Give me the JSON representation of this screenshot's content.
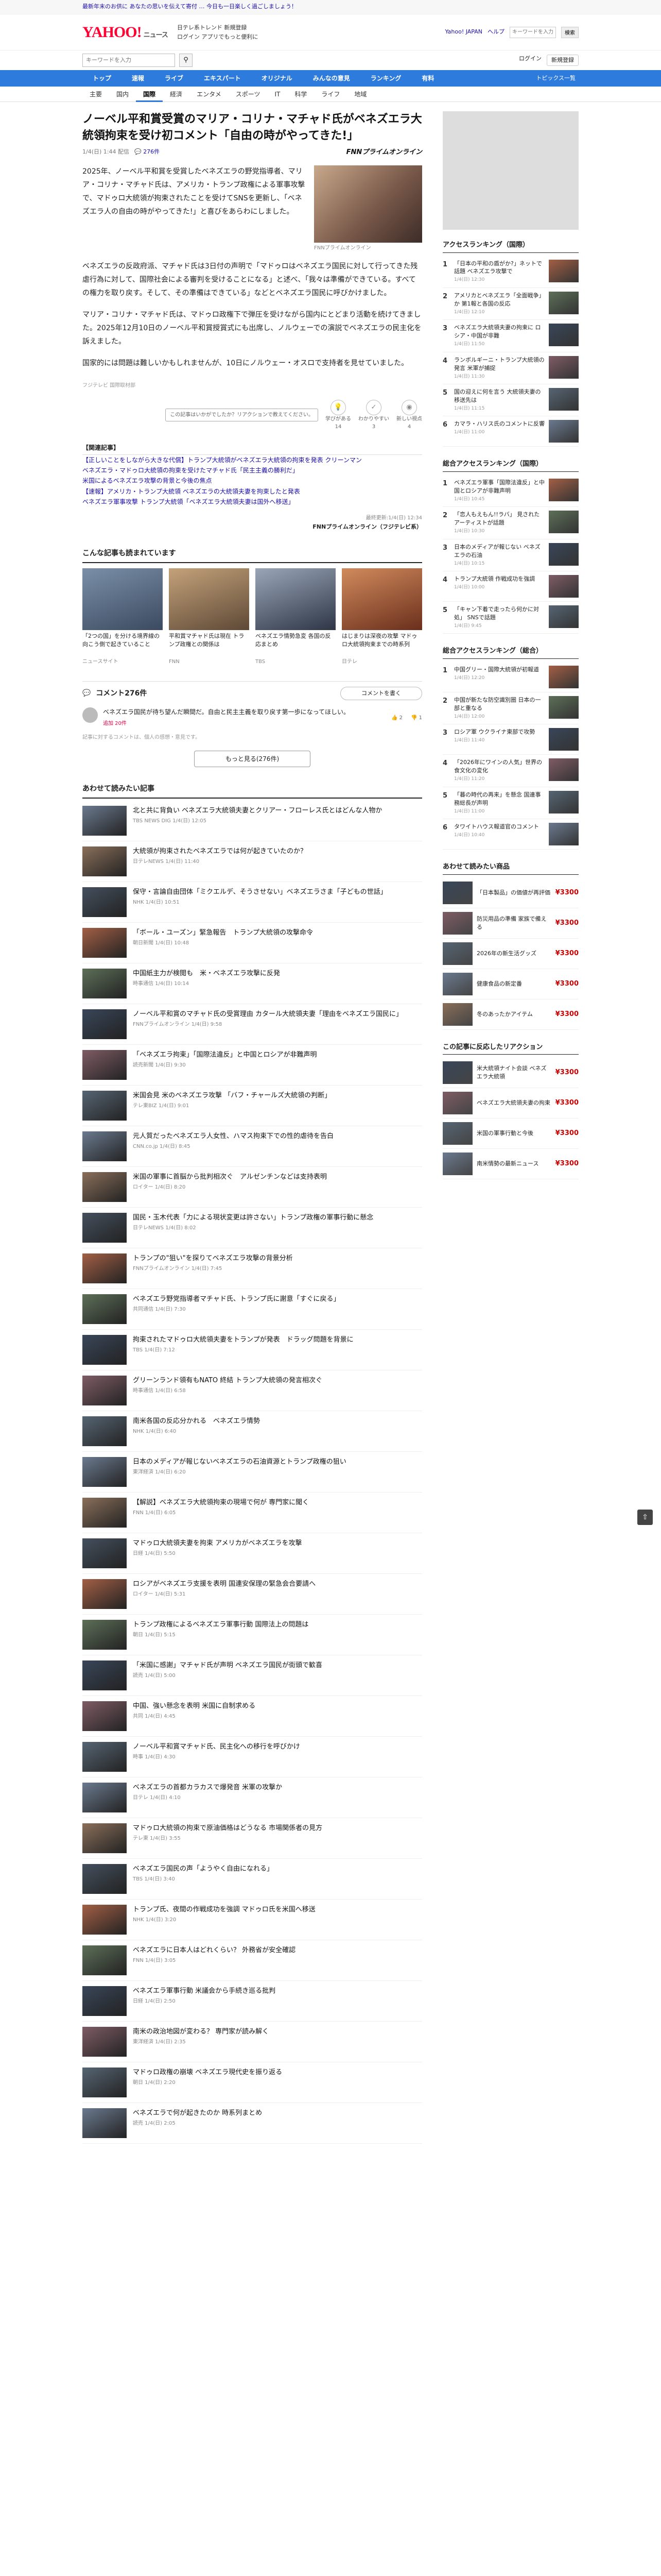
{
  "topbar": {
    "text": "最新年末のお供に あなたの思いを伝えて寄付 … 今日も一日楽しく過ごしましょう！"
  },
  "header": {
    "logo": "YAHOO!",
    "logo_sub": "ニュース",
    "links_line1": "日テレ系トレンド 新規登録",
    "links_line2": "ログイン アプリでもっと便利に",
    "right_links": [
      "Yahoo! JAPAN",
      "ヘルプ"
    ],
    "search_placeholder": "キーワードを入力",
    "search_btn": "検索"
  },
  "searchrow": {
    "placeholder": "キーワードを入力",
    "links": [
      "ログイン",
      "新規登録"
    ]
  },
  "categories": [
    "トップ",
    "速報",
    "ライブ",
    "エキスパート",
    "オリジナル",
    "みんなの意見",
    "ランキング",
    "有料"
  ],
  "topics_link": "トピックス一覧",
  "subtabs": [
    "主要",
    "国内",
    "国際",
    "経済",
    "エンタメ",
    "スポーツ",
    "IT",
    "科学",
    "ライフ",
    "地域"
  ],
  "article": {
    "title": "ノーベル平和賞受賞のマリア・コリナ・マチャド氏がベネズエラ大統領拘束を受け初コメント「自由の時がやってきた!」",
    "date": "1/4(日) 1:44 配信",
    "comment_count": "276件",
    "source": "FNNプライムオンライン",
    "lead": "2025年、ノーベル平和賞を受賞したベネズエラの野党指導者、マリア・コリナ・マチャド氏は、アメリカ・トランプ政権による軍事攻撃で、マドゥロ大統領が拘束されたことを受けてSNSを更新し、「ベネズエラ人の自由の時がやってきた!」と喜びをあらわにしました。",
    "image_caption": "FNNプライムオンライン",
    "paragraphs": [
      "ベネズエラの反政府派、マチャド氏は3日付の声明で「マドゥロはベネズエラ国民に対して行ってきた残虐行為に対して、国際社会による審判を受けることになる」と述べ、「我々は準備ができている。すべての権力を取り戻す。そして、その準備はできている」などとベネズエラ国民に呼びかけました。",
      "マリア・コリナ・マチャド氏は、マドゥロ政権下で弾圧を受けながら国内にとどまり活動を続けてきました。2025年12月10日のノーベル平和賞授賞式にも出席し、ノルウェーでの演説でベネズエラの民主化を訴えました。",
      "国家的には問題は難しいかもしれませんが、10日にノルウェー・オスロで支持者を見せていました。"
    ],
    "copyright": "フジテレビ 国際取材部",
    "reactions": [
      {
        "label": "学びがある",
        "count": "14"
      },
      {
        "label": "わかりやすい",
        "count": "3"
      },
      {
        "label": "新しい視点",
        "count": "4"
      }
    ],
    "reaction_tip": "この記事はいかがでしたか？リアクションで教えてください。",
    "related_head": "【関連記事】",
    "related": [
      "【正しいことをしながら大きな代償】トランプ大統領がベネズエラ大統領の拘束を発表 クリーンマン",
      "ベネズエラ・マドゥロ大統領の拘束を受けたマチャド氏「民主主義の勝利だ」",
      "米国によるベネズエラ攻撃の背景と今後の焦点",
      "【速報】アメリカ・トランプ大統領 ベネズエラの大統領夫妻を拘束したと発表",
      "ベネズエラ軍事攻撃 トランプ大統領「ベネズエラ大統領夫妻は国外へ移送」"
    ],
    "published": "最終更新:1/4(日) 12:34",
    "published_src": "FNNプライムオンライン（フジテレビ系）"
  },
  "recommend": {
    "head": "こんな記事も読まれています",
    "cards": [
      {
        "title": "「2つの国」を分ける境界線の向こう側で起きていること",
        "src": "ニュースサイト"
      },
      {
        "title": "平和賞マチャド氏は現在 トランプ政権との関係は",
        "src": "FNN"
      },
      {
        "title": "ベネズエラ情勢急変 各国の反応まとめ",
        "src": "TBS"
      },
      {
        "title": "はじまりは深夜の攻撃 マドゥロ大統領拘束までの時系列",
        "src": "日テレ"
      }
    ]
  },
  "comments": {
    "head": "コメント276件",
    "post_btn": "コメントを書く",
    "top": {
      "text": "ベネズエラ国民が待ち望んだ瞬間だ。自由と民主主義を取り戻す第一歩になってほしい。",
      "user": "追加 20件",
      "good": "2",
      "bad": "1"
    },
    "notice": "記事に対するコメントは、個人の感想・意見です。",
    "more": "もっと見る(276件)"
  },
  "list": {
    "head": "あわせて読みたい記事",
    "items": [
      {
        "title": "北と共に背負い ベネズエラ大統領夫妻とクリアー・フローレス氏とはどんな人物か",
        "src": "TBS NEWS DIG 1/4(日) 12:05"
      },
      {
        "title": "大統領が拘束されたベネズエラでは何が起きていたのか？",
        "src": "日テレNEWS 1/4(日) 11:40"
      },
      {
        "title": "保守・言論自由団体「ミクエルデ、そうさせない」ベネズエラさま「子どもの世話」",
        "src": "NHK 1/4(日) 10:51"
      },
      {
        "title": "「ボール・ユーズン」緊急報告　トランプ大統領の攻撃命令",
        "src": "朝日新聞 1/4(日) 10:48"
      },
      {
        "title": "中国紙主力が検閲も　米・ベネズエラ攻撃に反発",
        "src": "時事通信 1/4(日) 10:14"
      },
      {
        "title": "ノーベル平和賞のマチャド氏の受賞理由 カタール大統領夫妻「理由をベネズエラ国民に」",
        "src": "FNNプライムオンライン 1/4(日) 9:58"
      },
      {
        "title": "「ベネズエラ拘束」「国際法違反」と中国とロシアが非難声明",
        "src": "読売新聞 1/4(日) 9:30"
      },
      {
        "title": "米国会見 米のベネズエラ攻撃 「バフ・チャールズ大統領の判断」",
        "src": "テレ東BIZ 1/4(日) 9:01"
      },
      {
        "title": "元人質だったベネズエラ人女性、ハマス拘束下での性的虐待を告白",
        "src": "CNN.co.jp 1/4(日) 8:45"
      },
      {
        "title": "米国の軍事に首脳から批判相次ぐ　アルゼンチンなどは支持表明",
        "src": "ロイター 1/4(日) 8:20"
      },
      {
        "title": "国民・玉木代表「力による現状変更は許さない」トランプ政権の軍事行動に懸念",
        "src": "日テレNEWS 1/4(日) 8:02"
      },
      {
        "title": "トランプの\"狙い\"を探りてベネズエラ攻撃の背景分析",
        "src": "FNNプライムオンライン 1/4(日) 7:45"
      },
      {
        "title": "ベネズエラ野党指導者マチャド氏、トランプ氏に謝意「すぐに戻る」",
        "src": "共同通信 1/4(日) 7:30"
      },
      {
        "title": "拘束されたマドゥロ大統領夫妻をトランプが発表　ドラッグ問題を背景に",
        "src": "TBS 1/4(日) 7:12"
      },
      {
        "title": "グリーンランド領有もNATO 終結 トランプ大統領の発言相次ぐ",
        "src": "時事通信 1/4(日) 6:58"
      },
      {
        "title": "南米各国の反応分かれる　ベネズエラ情勢",
        "src": "NHK 1/4(日) 6:40"
      },
      {
        "title": "日本のメディアが報じないベネズエラの石油資源とトランプ政権の狙い",
        "src": "東洋経済 1/4(日) 6:20"
      },
      {
        "title": "【解説】ベネズエラ大統領拘束の現場で何が 専門家に聞く",
        "src": "FNN 1/4(日) 6:05"
      },
      {
        "title": "マドゥロ大統領夫妻を拘束 アメリカがベネズエラを攻撃",
        "src": "日経 1/4(日) 5:50"
      },
      {
        "title": "ロシアがベネズエラ支援を表明 国連安保理の緊急会合要請へ",
        "src": "ロイター 1/4(日) 5:31"
      },
      {
        "title": "トランプ政権によるベネズエラ軍事行動 国際法上の問題は",
        "src": "朝日 1/4(日) 5:15"
      },
      {
        "title": "「米国に感謝」マチャド氏が声明 ベネズエラ国民が街頭で歓喜",
        "src": "読売 1/4(日) 5:00"
      },
      {
        "title": "中国、強い懸念を表明 米国に自制求める",
        "src": "共同 1/4(日) 4:45"
      },
      {
        "title": "ノーベル平和賞マチャド氏、民主化への移行を呼びかけ",
        "src": "時事 1/4(日) 4:30"
      },
      {
        "title": "ベネズエラの首都カラカスで爆発音 米軍の攻撃か",
        "src": "日テレ 1/4(日) 4:10"
      },
      {
        "title": "マドゥロ大統領の拘束で原油価格はどうなる 市場関係者の見方",
        "src": "テレ東 1/4(日) 3:55"
      },
      {
        "title": "ベネズエラ国民の声「ようやく自由になれる」",
        "src": "TBS 1/4(日) 3:40"
      },
      {
        "title": "トランプ氏、夜間の作戦成功を強調 マドゥロ氏を米国へ移送",
        "src": "NHK 1/4(日) 3:20"
      },
      {
        "title": "ベネズエラに日本人はどれくらい？ 外務省が安全確認",
        "src": "FNN 1/4(日) 3:05"
      },
      {
        "title": "ベネズエラ軍事行動 米議会から手続き巡る批判",
        "src": "日経 1/4(日) 2:50"
      },
      {
        "title": "南米の政治地図が変わる？ 専門家が読み解く",
        "src": "東洋経済 1/4(日) 2:35"
      },
      {
        "title": "マドゥロ政権の崩壊 ベネズエラ現代史を振り返る",
        "src": "朝日 1/4(日) 2:20"
      },
      {
        "title": "ベネズエラで何が起きたのか 時系列まとめ",
        "src": "読売 1/4(日) 2:05"
      }
    ]
  },
  "side": {
    "ad_label": "広告",
    "ranking1": {
      "head": "アクセスランキング（国際）",
      "items": [
        {
          "t": "「日本の平和の盾がか?」ネットで話題 ベネズエラ攻撃で",
          "s": "1/4(日) 12:30"
        },
        {
          "t": "アメリカとベネズエラ「全面戦争」か 第1報と各国の反応",
          "s": "1/4(日) 12:10"
        },
        {
          "t": "ベネズエラ大統領夫妻の拘束に ロシア・中国が非難",
          "s": "1/4(日) 11:50"
        },
        {
          "t": "ランボルギーニ・トランプ大統領の発言 米軍が捕捉",
          "s": "1/4(日) 11:30"
        },
        {
          "t": "国の迎えに何を言う 大統領夫妻の移送先は",
          "s": "1/4(日) 11:15"
        },
        {
          "t": "カマラ・ハリス氏のコメントに反響",
          "s": "1/4(日) 11:00"
        }
      ]
    },
    "ranking2": {
      "head": "総合アクセスランキング（国際）",
      "items": [
        {
          "t": "ベネズエラ軍事「国際法違反」と中国とロシアが非難声明",
          "s": "1/4(日) 10:45"
        },
        {
          "t": "「恋人もえもん!!ラバ」 見されたアーティストが話題",
          "s": "1/4(日) 10:30"
        },
        {
          "t": "日本のメディアが報じない ベネズエラの石油",
          "s": "1/4(日) 10:15"
        },
        {
          "t": "トランプ大統領 作戦成功を強調",
          "s": "1/4(日) 10:00"
        },
        {
          "t": "「キャン下着で走ったら何かに対処」 SNSで話題",
          "s": "1/4(日) 9:45"
        }
      ]
    },
    "ranking3": {
      "head": "総合アクセスランキング（総合）",
      "items": [
        {
          "t": "中国グリー・国際大統領が初報道",
          "s": "1/4(日) 12:20"
        },
        {
          "t": "中国が新たな防空識別圏 日本の一部と重なる",
          "s": "1/4(日) 12:00"
        },
        {
          "t": "ロシア軍 ウクライナ東部で攻勢",
          "s": "1/4(日) 11:40"
        },
        {
          "t": "「2026年にワインの人気」世界の食文化の変化",
          "s": "1/4(日) 11:20"
        },
        {
          "t": "「暮の時代の再来」を懸念 国連事務総長が声明",
          "s": "1/4(日) 11:00"
        },
        {
          "t": "タワイトハウス報道官のコメント",
          "s": "1/4(日) 10:40"
        }
      ]
    },
    "paypay": {
      "head": "あわせて読みたい商品",
      "items": [
        {
          "t": "「日本製品」の価値が再評価",
          "p": "¥3300"
        },
        {
          "t": "防災用品の準備 家族で備える",
          "p": "¥3300"
        },
        {
          "t": "2026年の新生活グッズ",
          "p": "¥3300"
        },
        {
          "t": "健康食品の新定番",
          "p": "¥3300"
        },
        {
          "t": "冬のあったかアイテム",
          "p": "¥3300"
        }
      ]
    },
    "reactions": {
      "head": "この記事に反応したリアクション",
      "items": [
        {
          "t": "米大統領ナイト会談 ベネズエラ大統領",
          "p": "¥3300"
        },
        {
          "t": "ベネズエラ大統領夫妻の拘束",
          "p": "¥3300"
        },
        {
          "t": "米国の軍事行動と今後",
          "p": "¥3300"
        },
        {
          "t": "南米情勢の最新ニュース",
          "p": "¥3300"
        }
      ]
    }
  }
}
